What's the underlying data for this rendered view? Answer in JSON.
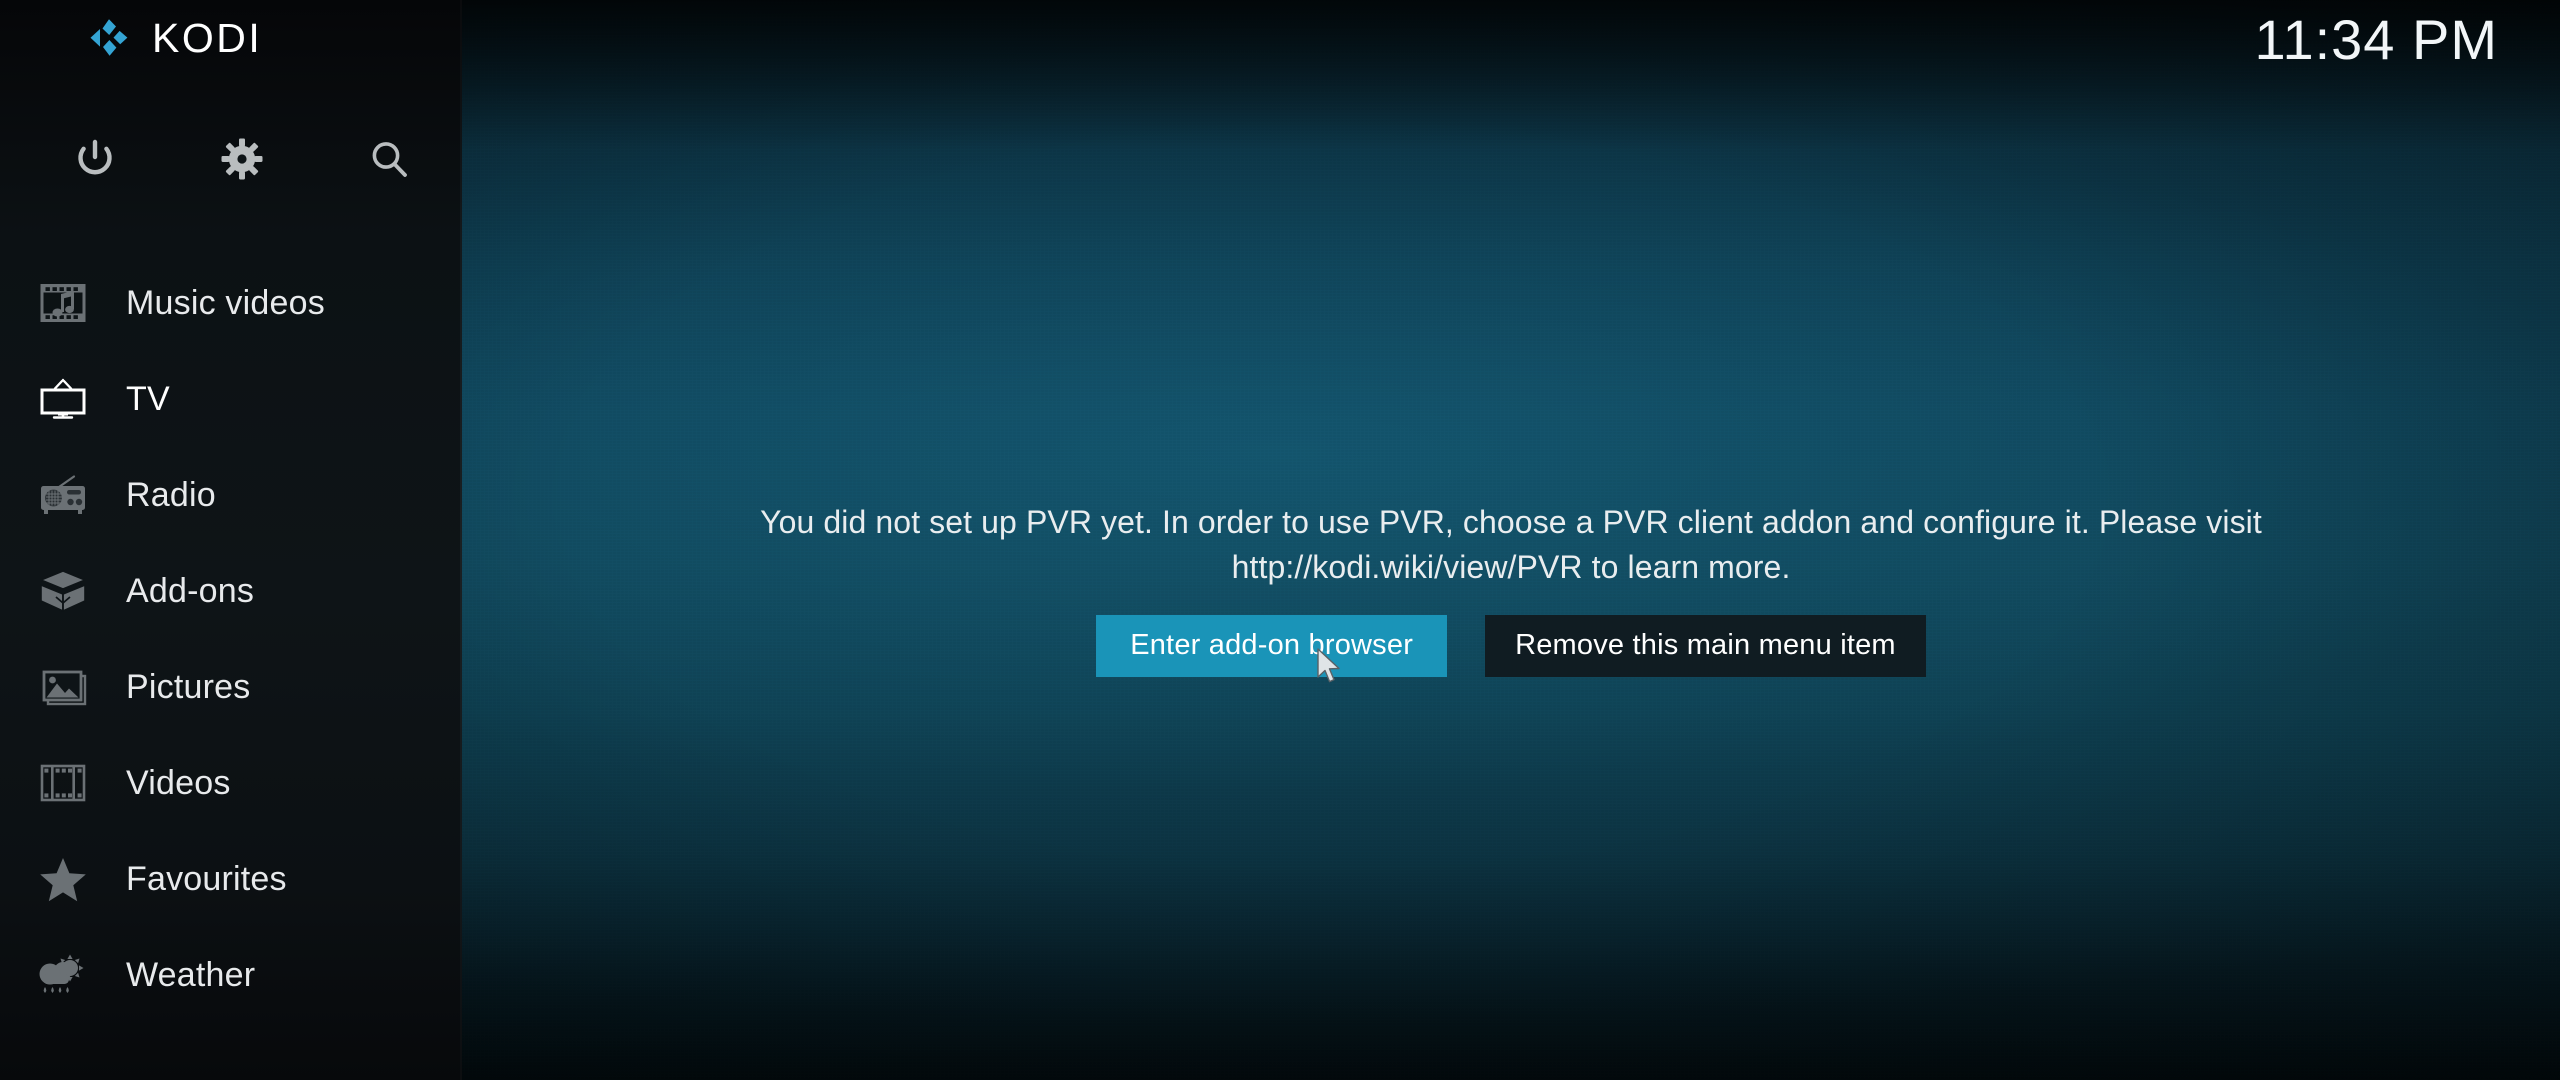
{
  "app": {
    "name": "KODI",
    "logo_icon": "kodi-logo-icon",
    "accent_color": "#1a94b8",
    "sidebar_bg": "#0e1417",
    "background_color": "#104658"
  },
  "sidebar": {
    "top_icons": [
      {
        "name": "power-icon",
        "label": "Power"
      },
      {
        "name": "gear-icon",
        "label": "Settings"
      },
      {
        "name": "search-icon",
        "label": "Search"
      }
    ],
    "items": [
      {
        "label": "Music videos",
        "icon": "music-videos-icon",
        "selected": false
      },
      {
        "label": "TV",
        "icon": "tv-icon",
        "selected": true
      },
      {
        "label": "Radio",
        "icon": "radio-icon",
        "selected": false
      },
      {
        "label": "Add-ons",
        "icon": "addons-box-icon",
        "selected": false
      },
      {
        "label": "Pictures",
        "icon": "pictures-icon",
        "selected": false
      },
      {
        "label": "Videos",
        "icon": "videos-filmstrip-icon",
        "selected": false
      },
      {
        "label": "Favourites",
        "icon": "star-icon",
        "selected": false
      },
      {
        "label": "Weather",
        "icon": "weather-cloud-rain-sun-icon",
        "selected": false
      }
    ]
  },
  "main": {
    "clock": "11:34 PM",
    "message": "You did not set up PVR yet. In order to use PVR, choose a PVR client addon and configure it. Please visit http://kodi.wiki/view/PVR to learn more.",
    "buttons": {
      "primary_label": "Enter add-on browser",
      "secondary_label": "Remove this main menu item"
    }
  }
}
